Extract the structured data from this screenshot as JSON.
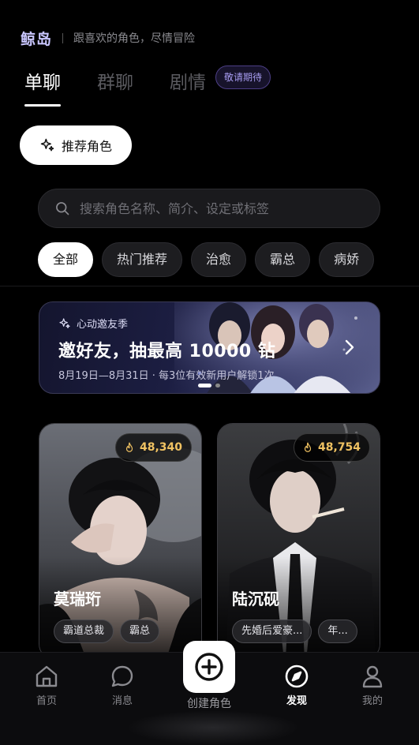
{
  "header": {
    "brand": "鲸岛",
    "tagline": "跟喜欢的角色，尽情冒险"
  },
  "tabs": [
    {
      "label": "单聊",
      "active": true
    },
    {
      "label": "群聊",
      "active": false
    },
    {
      "label": "剧情",
      "active": false
    }
  ],
  "tab_badge": "敬请期待",
  "recommend_button": {
    "label": "推荐角色",
    "icon": "sparkle-icon"
  },
  "search": {
    "placeholder": "搜索角色名称、简介、设定或标签",
    "value": ""
  },
  "chips": [
    {
      "label": "全部",
      "active": true
    },
    {
      "label": "热门推荐"
    },
    {
      "label": "治愈"
    },
    {
      "label": "霸总"
    },
    {
      "label": "病娇"
    }
  ],
  "banner": {
    "kicker": "心动邀友季",
    "title": "邀好友，抽最高 10000 钻",
    "subtitle": "8月19日—8月31日 · 每3位有效新用户解锁1次",
    "active_slide": 1,
    "slide_count": 2
  },
  "cards": [
    {
      "name": "莫瑞珩",
      "popularity": "48,340",
      "tags": [
        "霸道总裁",
        "霸总"
      ]
    },
    {
      "name": "陆沉砚",
      "popularity": "48,754",
      "tags": [
        "先婚后爱豪...",
        "年..."
      ]
    }
  ],
  "bottom_nav": {
    "home": "首页",
    "messages": "消息",
    "create": "创建角色",
    "discover": "发现",
    "profile": "我的",
    "active": "discover"
  },
  "colors": {
    "accent": "#c9c6ff",
    "badge": "#a79cf0",
    "hot": "#f0c262",
    "background": "#000000"
  }
}
